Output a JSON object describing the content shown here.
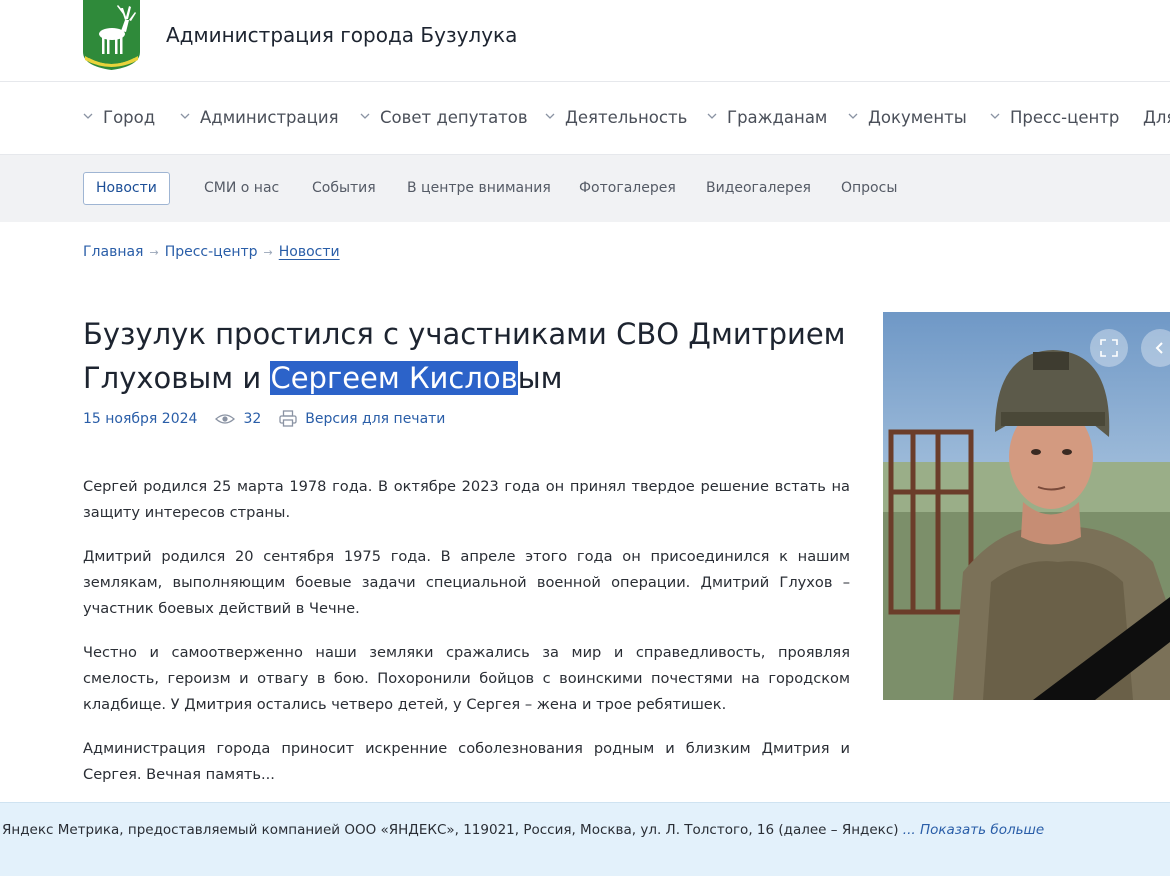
{
  "header": {
    "site_title": "Администрация города Бузулука"
  },
  "main_nav": [
    {
      "label": "Город"
    },
    {
      "label": "Администрация"
    },
    {
      "label": "Совет депутатов"
    },
    {
      "label": "Деятельность"
    },
    {
      "label": "Гражданам"
    },
    {
      "label": "Документы"
    },
    {
      "label": "Пресс-центр"
    },
    {
      "label": "Для"
    }
  ],
  "sub_nav": [
    {
      "label": "Новости",
      "active": true
    },
    {
      "label": "СМИ о нас"
    },
    {
      "label": "События"
    },
    {
      "label": "В центре внимания"
    },
    {
      "label": "Фотогалерея"
    },
    {
      "label": "Видеогалерея"
    },
    {
      "label": "Опросы"
    }
  ],
  "breadcrumb": {
    "items": [
      "Главная",
      "Пресс-центр",
      "Новости"
    ],
    "separator": "→"
  },
  "article": {
    "title_part1": "Бузулук простился с участниками СВО Дмитрием Глуховым и ",
    "title_highlight": "Сергеем Кислов",
    "title_part2": "ым",
    "date": "15 ноября 2024",
    "views": "32",
    "print_label": "Версия для печати",
    "paragraphs": [
      "Сергей   родился  25 марта 1978 года. В октябре 2023 года  он принял твердое решение  встать на защиту интересов страны.",
      "Дмитрий родился 20 сентября 1975 года. В апреле этого года он присоединился  к нашим землякам, выполняющим боевые задачи  специальной военной операции.  Дмитрий Глухов – участник боевых действий в Чечне.",
      "Честно и самоотверженно наши земляки сражались за мир и справедливость, проявляя смелость,  героизм и отвагу в бою. Похоронили бойцов  с воинскими почестями на  городском кладбище. У Дмитрия  остались четверо детей,  у Сергея  – жена и трое ребятишек.",
      "Администрация города приносит искренние соболезнования родным и близким Дмитрия и Сергея.  Вечная память..."
    ]
  },
  "cookie_bar": {
    "text": "Яндекс Метрика, предоставляемый компанией ООО «ЯНДЕКС», 119021, Россия, Москва, ул. Л. Толстого, 16 (далее – Яндекс) ",
    "more": "... Показать больше"
  },
  "colors": {
    "link": "#2a5ea8",
    "highlight": "#2c63c9",
    "cookie_bg": "#e3f1fb"
  },
  "icons": [
    "coat-of-arms-logo",
    "chevron-down-icon",
    "eye-icon",
    "printer-icon",
    "fullscreen-icon",
    "chevron-left-icon"
  ]
}
